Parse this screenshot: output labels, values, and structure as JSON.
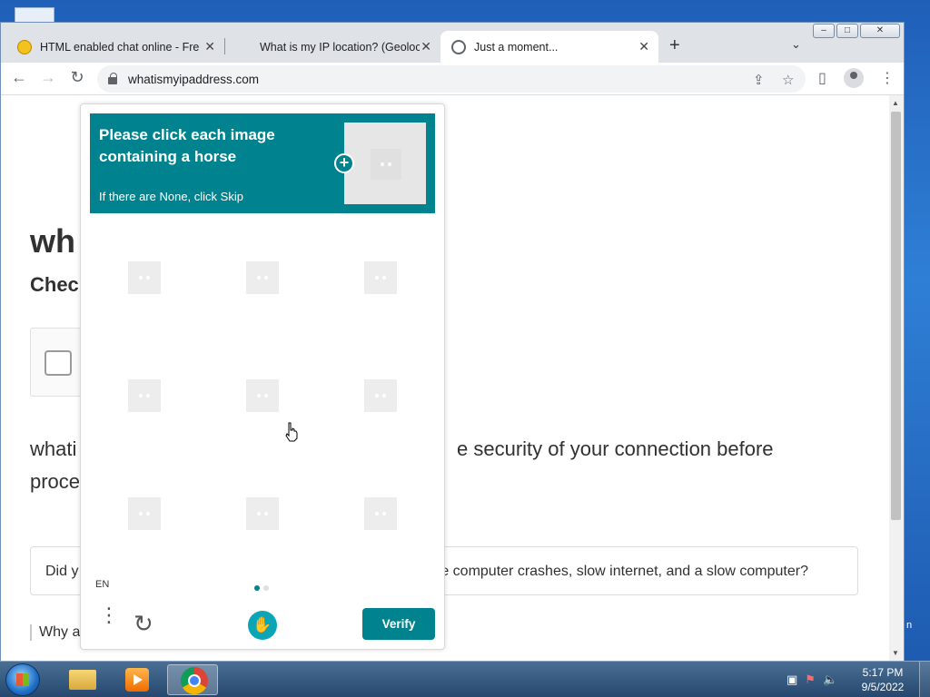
{
  "browser": {
    "tabs": [
      {
        "title": "HTML enabled chat online - Free",
        "favicon": "emoji-face"
      },
      {
        "title": "What is my IP location? (Geoloca",
        "favicon": "blank"
      },
      {
        "title": "Just a moment...",
        "favicon": "globe"
      }
    ],
    "new_tab_label": "+",
    "tab_menu_label": "⌄",
    "url": "whatismyipaddress.com",
    "window_controls": {
      "minimize": "–",
      "maximize": "□",
      "close": "✕"
    }
  },
  "page": {
    "heading_partial": "wh",
    "subheading_partial": "Checl",
    "paragraph_left_line1": "whati",
    "paragraph_right_line1": "e security of your connection before",
    "paragraph_line2": "proce",
    "faq_left": "Did y",
    "faq_right": "re computer crashes, slow internet, and a slow computer?",
    "why_partial": "Why a",
    "edge_char": "n"
  },
  "hcaptcha": {
    "prompt_title": "Please click each image containing a horse",
    "prompt_sub": "If there are None, click Skip",
    "plus_symbol": "+",
    "language": "EN",
    "verify_label": "Verify",
    "menu_glyph": "⋮",
    "refresh_glyph": "↻",
    "logo_glyph": "✋",
    "images_count": 9,
    "accent_color": "#00838f"
  },
  "taskbar": {
    "apps": [
      "explorer",
      "media-player",
      "chrome"
    ],
    "clock_time": "5:17 PM",
    "clock_date": "9/5/2022",
    "tray_icons": [
      "network-icon",
      "flag-icon",
      "volume-icon"
    ]
  }
}
